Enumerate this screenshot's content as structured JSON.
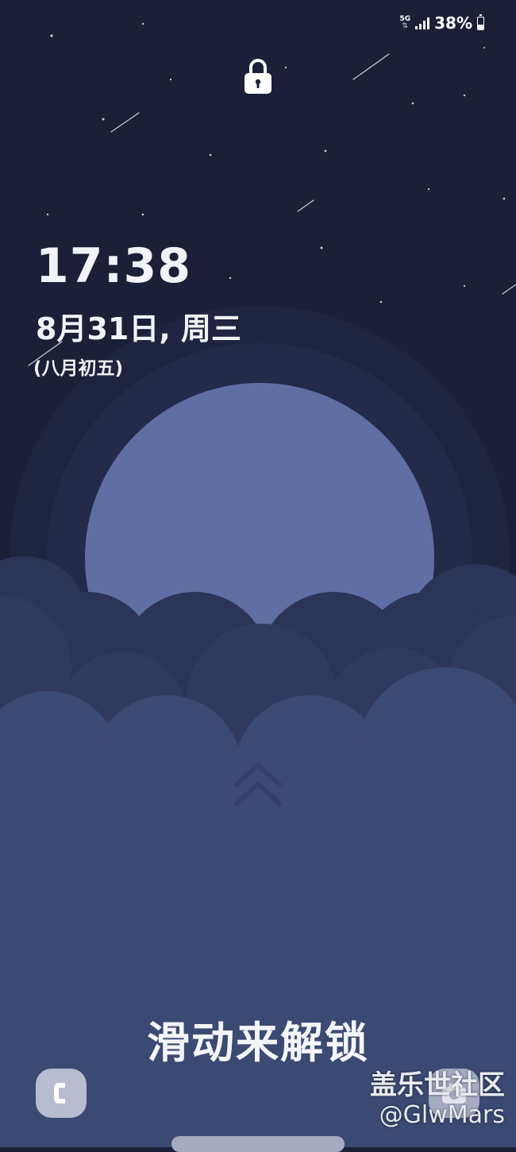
{
  "status_bar": {
    "network_type": "5G",
    "network_arrows": "⇅",
    "battery_percent": "38%",
    "battery_level": 0.38,
    "signal_bars": 4
  },
  "lock_screen": {
    "lock_icon": "padlock-icon",
    "time": "17:38",
    "date": "8月31日, 周三",
    "lunar_date": "(八月初五)",
    "swipe_icon": "double-chevron-up-icon",
    "unlock_hint": "滑动来解锁"
  },
  "shortcuts": {
    "left_icon": "phone-icon",
    "right_icon": "camera-icon"
  },
  "watermark": {
    "line1": "盖乐世社区",
    "line2": "@GlwMars"
  },
  "colors": {
    "sky": "#1b2038",
    "moon": "#5f6ea3",
    "cloud_front": "#3b4a73",
    "text": "#f2f3f6"
  }
}
